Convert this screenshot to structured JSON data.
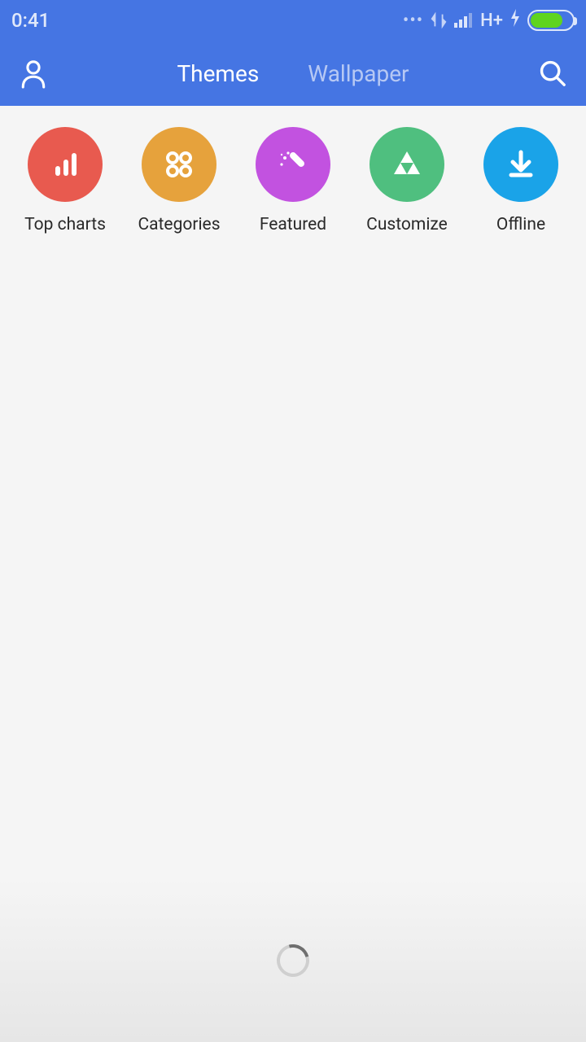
{
  "status": {
    "time": "0:41",
    "network_label": "H+"
  },
  "header": {
    "tabs": {
      "themes": "Themes",
      "wallpaper": "Wallpaper"
    }
  },
  "categories": {
    "top_charts": "Top charts",
    "categories": "Categories",
    "featured": "Featured",
    "customize": "Customize",
    "offline": "Offline"
  },
  "colors": {
    "header_bg": "#4575e3",
    "cat_red": "#e85a4f",
    "cat_orange": "#e6a23c",
    "cat_purple": "#c252e0",
    "cat_green": "#4fbf7f",
    "cat_blue": "#1aa3e8"
  }
}
